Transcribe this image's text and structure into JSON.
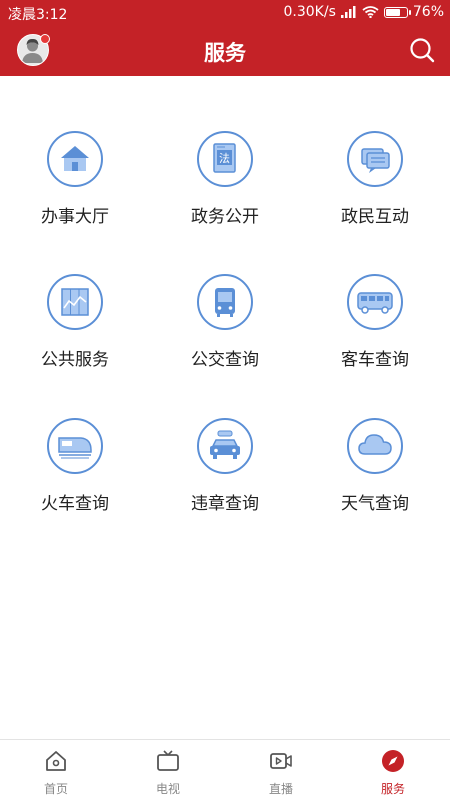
{
  "status_bar": {
    "time": "凌晨3:12",
    "network_speed": "0.30K/s",
    "battery": "76%",
    "battery_level": 0.76
  },
  "header": {
    "title": "服务"
  },
  "services": [
    {
      "label": "办事大厅",
      "icon": "building-icon"
    },
    {
      "label": "政务公开",
      "icon": "law-book-icon"
    },
    {
      "label": "政民互动",
      "icon": "chat-bubbles-icon"
    },
    {
      "label": "公共服务",
      "icon": "chart-board-icon"
    },
    {
      "label": "公交查询",
      "icon": "bus-front-icon"
    },
    {
      "label": "客车查询",
      "icon": "coach-bus-icon"
    },
    {
      "label": "火车查询",
      "icon": "train-icon"
    },
    {
      "label": "违章查询",
      "icon": "traffic-car-icon"
    },
    {
      "label": "天气查询",
      "icon": "cloud-icon"
    }
  ],
  "bottom_nav": [
    {
      "label": "首页",
      "icon": "home-icon"
    },
    {
      "label": "电视",
      "icon": "tv-icon"
    },
    {
      "label": "直播",
      "icon": "video-icon"
    },
    {
      "label": "服务",
      "icon": "compass-icon",
      "active": true
    }
  ],
  "colors": {
    "brand_red": "#c42227",
    "icon_blue": "#5b8fd6",
    "icon_fill": "#a9c8f2"
  }
}
